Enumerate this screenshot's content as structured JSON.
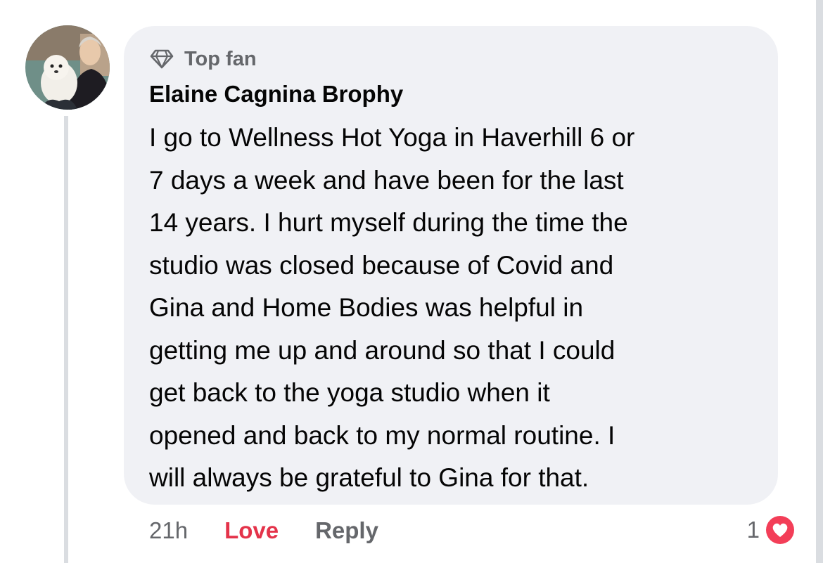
{
  "comment": {
    "badge_label": "Top fan",
    "badge_icon": "diamond-icon",
    "author": "Elaine Cagnina Brophy",
    "lines": [
      "I go to Wellness Hot Yoga in Haverhill 6 or",
      "7 days a week and have been for the last",
      "14 years. I hurt myself during the time the",
      "studio was closed because of Covid and",
      "Gina and Home Bodies was helpful in",
      "getting me up and around so that I could",
      "get back to the yoga studio when it",
      "opened and back to my normal routine. I",
      "will always be grateful to Gina for that."
    ]
  },
  "actions": {
    "time": "21h",
    "love_label": "Love",
    "reply_label": "Reply"
  },
  "reactions": {
    "count": "1",
    "icon": "heart-reaction-icon",
    "color": "#f33e58"
  },
  "colors": {
    "bubble": "#f0f1f5",
    "love": "#e4334a",
    "secondary_text": "#65676b"
  }
}
